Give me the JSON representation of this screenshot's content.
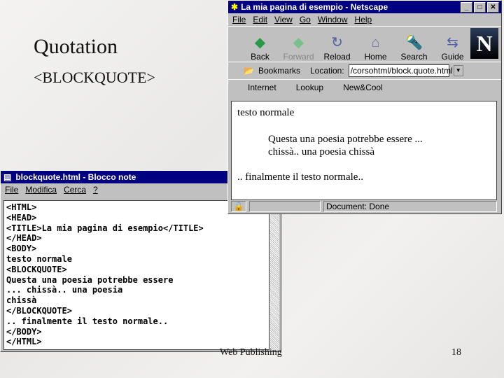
{
  "slide": {
    "title": "Quotation",
    "subtitle": "<BLOCKQUOTE>",
    "footer": "Web Publishing",
    "page": "18"
  },
  "browser": {
    "title": "La mia pagina di esempio - Netscape",
    "menu": [
      "File",
      "Edit",
      "View",
      "Go",
      "Window",
      "Help"
    ],
    "toolbar": [
      {
        "label": "Back",
        "icon": "back-icon"
      },
      {
        "label": "Forward",
        "icon": "forward-icon"
      },
      {
        "label": "Reload",
        "icon": "reload-icon"
      },
      {
        "label": "Home",
        "icon": "home-icon"
      },
      {
        "label": "Search",
        "icon": "search-icon"
      },
      {
        "label": "Guide",
        "icon": "guide-icon"
      }
    ],
    "logo": "N",
    "bookmarks": "Bookmarks",
    "location_label": "Location:",
    "location_value": "/corsohtml/block.quote.html",
    "personal": [
      "Internet",
      "Lookup",
      "New&Cool"
    ],
    "content": {
      "normal": "testo normale",
      "quote1": "Questa una poesia potrebbe essere ...",
      "quote2": "chissà.. una poesia chissà",
      "end": ".. finalmente il testo normale.."
    },
    "status": "Document: Done"
  },
  "notepad": {
    "title": "blockquote.html - Blocco note",
    "menu": [
      "File",
      "Modifica",
      "Cerca",
      "?"
    ],
    "text": "<HTML>\n<HEAD>\n<TITLE>La mia pagina di esempio</TITLE>\n</HEAD>\n<BODY>\ntesto normale\n<BLOCKQUOTE>\nQuesta una poesia potrebbe essere\n... chissà.. una poesia\nchissà\n</BLOCKQUOTE>\n.. finalmente il testo normale..\n</BODY>\n</HTML>"
  }
}
